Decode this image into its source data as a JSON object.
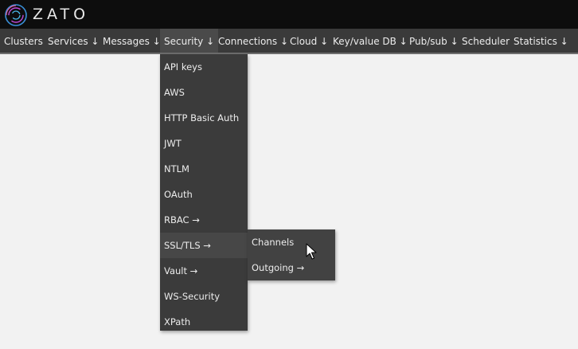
{
  "header": {
    "logo_text": "ZATO"
  },
  "nav": {
    "items": [
      {
        "label": "Clusters"
      },
      {
        "label": "Services ↓"
      },
      {
        "label": "Messages ↓"
      },
      {
        "label": "Security ↓"
      },
      {
        "label": "Connections ↓"
      },
      {
        "label": "Cloud ↓"
      },
      {
        "label": "Key/value DB ↓"
      },
      {
        "label": "Pub/sub ↓"
      },
      {
        "label": "Scheduler"
      },
      {
        "label": "Statistics ↓"
      }
    ],
    "active_item": "Security ↓"
  },
  "security_menu": {
    "items": [
      {
        "label": "API keys"
      },
      {
        "label": "AWS"
      },
      {
        "label": "HTTP Basic Auth"
      },
      {
        "label": "JWT"
      },
      {
        "label": "NTLM"
      },
      {
        "label": "OAuth"
      },
      {
        "label": "RBAC →"
      },
      {
        "label": "SSL/TLS →"
      },
      {
        "label": "Vault →"
      },
      {
        "label": "WS-Security"
      },
      {
        "label": "XPath"
      }
    ],
    "hovered_item": "SSL/TLS →"
  },
  "ssl_submenu": {
    "items": [
      {
        "label": "Channels"
      },
      {
        "label": "Outgoing →"
      }
    ]
  },
  "colors": {
    "header_bg": "#0d0d0d",
    "nav_bg": "#3a3a3a",
    "menu_bg": "#3b3b3b",
    "menu_hover_bg": "#474747",
    "page_bg": "#f2f2f2",
    "logo_accent": "#3a8fd8"
  },
  "icons": {
    "logo": "zato-logo-icon",
    "cursor": "mouse-pointer-icon"
  }
}
